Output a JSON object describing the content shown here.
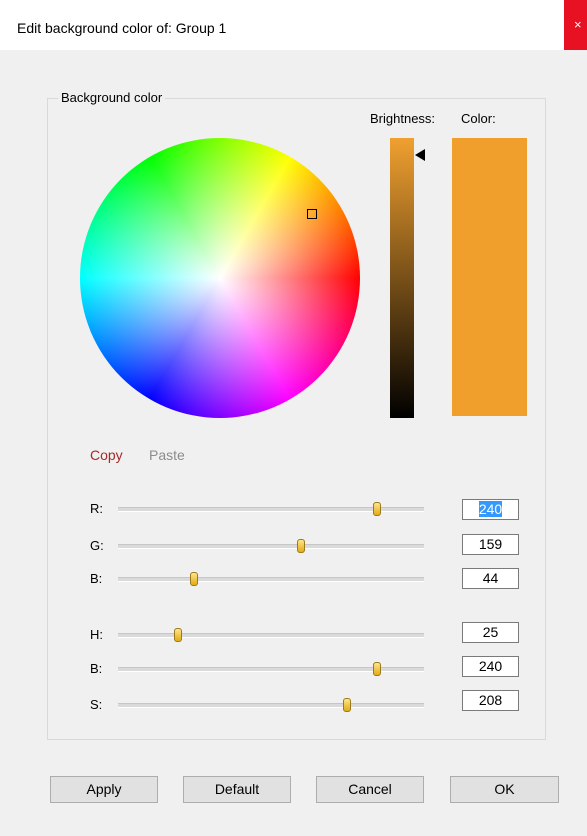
{
  "window": {
    "title": "Edit background color of: Group 1",
    "close_glyph": "×"
  },
  "group": {
    "label": "Background color"
  },
  "wheel": {
    "selected_hue_deg": 25,
    "selected_saturation": 0.82
  },
  "brightness": {
    "label": "Brightness:",
    "level": 0.94
  },
  "color": {
    "label": "Color:",
    "value": "#f09f2c"
  },
  "actions": {
    "copy": "Copy",
    "paste": "Paste"
  },
  "sliders": {
    "r": {
      "label": "R:",
      "value": "240",
      "max": 255,
      "selected": true
    },
    "g": {
      "label": "G:",
      "value": "159",
      "max": 255
    },
    "b": {
      "label": "B:",
      "value": "44",
      "max": 255
    },
    "h": {
      "label": "H:",
      "value": "25",
      "max": 240
    },
    "bri": {
      "label": "B:",
      "value": "240",
      "max": 255
    },
    "s": {
      "label": "S:",
      "value": "208",
      "max": 255
    }
  },
  "buttons": {
    "apply": "Apply",
    "default": "Default",
    "cancel": "Cancel",
    "ok": "OK"
  }
}
